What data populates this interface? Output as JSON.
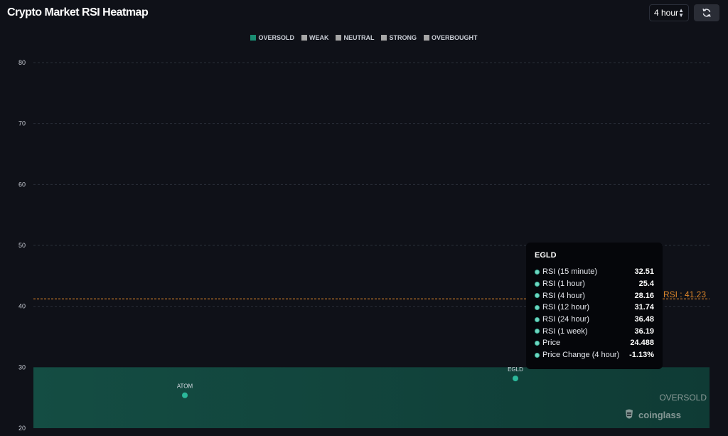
{
  "header": {
    "title": "Crypto Market RSI Heatmap",
    "interval_value": "4 hour"
  },
  "legend": [
    {
      "label": "OVERSOLD",
      "color": "#1a8c72"
    },
    {
      "label": "WEAK",
      "color": "#a6a6a6"
    },
    {
      "label": "NEUTRAL",
      "color": "#a6a6a6"
    },
    {
      "label": "STRONG",
      "color": "#a6a6a6"
    },
    {
      "label": "OVERBOUGHT",
      "color": "#a6a6a6"
    }
  ],
  "colors": {
    "background": "#0f1118",
    "oversold_band": "#144d43",
    "point": "#2bb89a",
    "avg_line": "#d9842a",
    "grid": "#2a2e39"
  },
  "chart_data": {
    "type": "scatter",
    "title": "Crypto Market RSI Heatmap",
    "ylim": [
      20,
      80
    ],
    "yticks": [
      20,
      30,
      40,
      50,
      60,
      70,
      80
    ],
    "grid": true,
    "average_rsi": 41.23,
    "average_label": "RSI : 41.23",
    "oversold_band": [
      20,
      30
    ],
    "band_label": "OVERSOLD",
    "points": [
      {
        "label": "ATOM",
        "rsi": 25.4
      },
      {
        "label": "EGLD",
        "rsi": 28.16
      }
    ]
  },
  "tooltip": {
    "title": "EGLD",
    "rows": [
      {
        "label": "RSI (15 minute)",
        "value": "32.51"
      },
      {
        "label": "RSI (1 hour)",
        "value": "25.4"
      },
      {
        "label": "RSI (4 hour)",
        "value": "28.16"
      },
      {
        "label": "RSI (12 hour)",
        "value": "31.74"
      },
      {
        "label": "RSI (24 hour)",
        "value": "36.48"
      },
      {
        "label": "RSI (1 week)",
        "value": "36.19"
      },
      {
        "label": "Price",
        "value": "24.488"
      },
      {
        "label": "Price Change (4 hour)",
        "value": "-1.13%"
      }
    ]
  },
  "watermark": {
    "text": "coinglass",
    "icon": "coinglass-logo-icon"
  }
}
